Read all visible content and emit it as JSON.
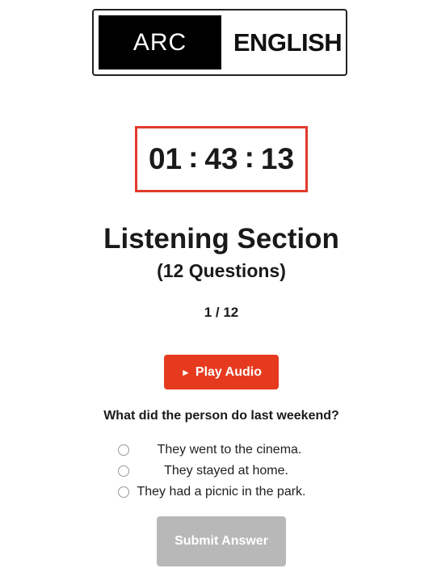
{
  "logo": {
    "left_text": "ARC",
    "right_text": "ENGLISH"
  },
  "timer": {
    "hours": "01",
    "minutes": "43",
    "seconds": "13",
    "separator": ":",
    "border_color": "#e13b2b"
  },
  "section": {
    "title": "Listening Section",
    "subtitle": "(12 Questions)",
    "progress": "1 / 12"
  },
  "play_button": {
    "icon": "play-icon",
    "icon_glyph": "►",
    "label": "Play Audio",
    "color": "#e63a1f"
  },
  "question": {
    "text": "What did the person do last weekend?",
    "options": [
      "They went to the cinema.",
      "They stayed at home.",
      "They had a picnic in the park."
    ]
  },
  "submit_button": {
    "label": "Submit Answer",
    "state": "disabled",
    "color": "#b8b8b8"
  }
}
